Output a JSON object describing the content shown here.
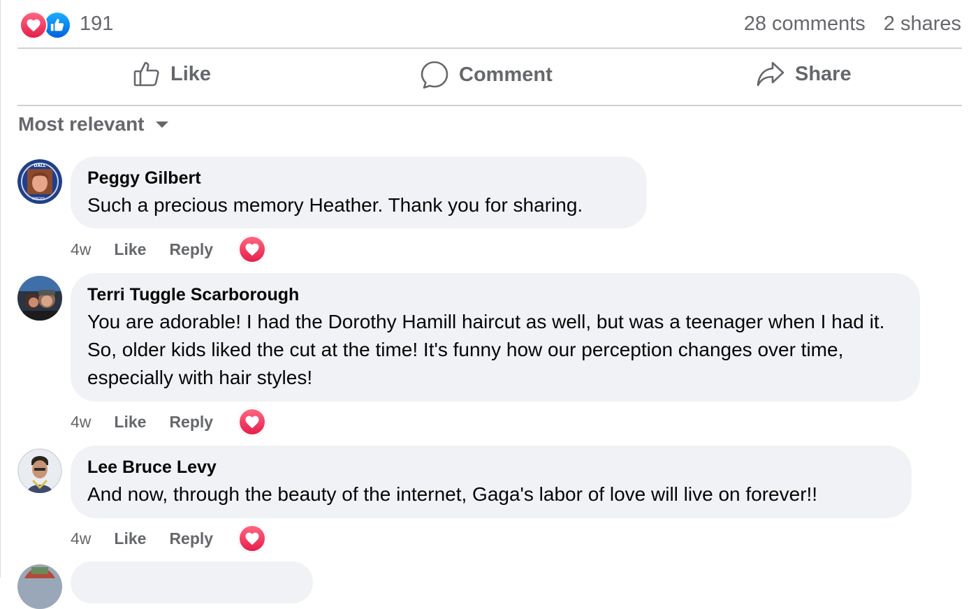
{
  "summary": {
    "reaction_icons": [
      "love-icon",
      "like-icon"
    ],
    "reaction_count": "191",
    "comments_count": "28 comments",
    "shares_count": "2 shares"
  },
  "actions": {
    "like_label": "Like",
    "comment_label": "Comment",
    "share_label": "Share"
  },
  "sort": {
    "label": "Most relevant",
    "icon": "caret-down-icon"
  },
  "comments": [
    {
      "author": "Peggy Gilbert",
      "text": "Such a precious memory Heather. Thank you for sharing.",
      "age": "4w",
      "like_label": "Like",
      "reply_label": "Reply",
      "reaction": "love-icon"
    },
    {
      "author": "Terri Tuggle Scarborough",
      "text": "You are adorable! I had the Dorothy Hamill haircut as well, but was a teenager when I had it. So, older kids liked the cut at the time! It's funny how our perception changes over time, especially with hair styles!",
      "age": "4w",
      "like_label": "Like",
      "reply_label": "Reply",
      "reaction": "love-icon"
    },
    {
      "author": "Lee Bruce Levy",
      "text": "And now, through the beauty of the internet, Gaga's labor of love will live on forever!!",
      "age": "4w",
      "like_label": "Like",
      "reply_label": "Reply",
      "reaction": "love-icon"
    }
  ],
  "colors": {
    "secondary_text": "#65676b",
    "bubble_bg": "#f0f2f5",
    "divider": "#ced0d4",
    "love_red": "#f33e58",
    "like_blue": "#0866ff"
  }
}
